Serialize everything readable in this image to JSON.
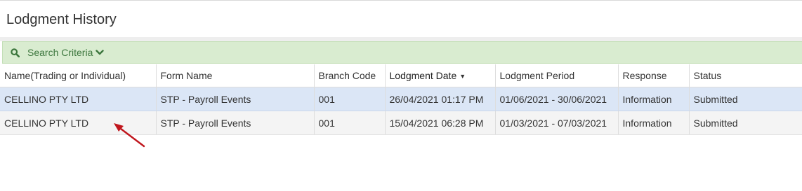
{
  "page": {
    "title": "Lodgment History"
  },
  "search_panel": {
    "label": "Search Criteria",
    "icon": "search-icon",
    "toggle_icon": "chevron-down-icon",
    "accent": "#3c763d",
    "background": "#d9ecd0"
  },
  "table": {
    "columns": [
      {
        "label": "Name(Trading or Individual)"
      },
      {
        "label": "Form Name"
      },
      {
        "label": "Branch Code"
      },
      {
        "label": "Lodgment Date",
        "sort": "descending"
      },
      {
        "label": "Lodgment Period"
      },
      {
        "label": "Response"
      },
      {
        "label": "Status"
      }
    ],
    "rows": [
      {
        "selected": true,
        "cells": [
          "CELLINO PTY LTD",
          "STP - Payroll Events",
          "001",
          "26/04/2021 01:17 PM",
          "01/06/2021 - 30/06/2021",
          "Information",
          "Submitted"
        ]
      },
      {
        "selected": false,
        "cells": [
          "CELLINO PTY LTD",
          "STP - Payroll Events",
          "001",
          "15/04/2021 06:28 PM",
          "01/03/2021 - 07/03/2021",
          "Information",
          "Submitted"
        ]
      }
    ],
    "selected_row_color": "#dbe6f6",
    "row_color": "#f4f4f4"
  },
  "annotation": {
    "icon": "red-arrow-icon",
    "color": "#c0161d"
  }
}
